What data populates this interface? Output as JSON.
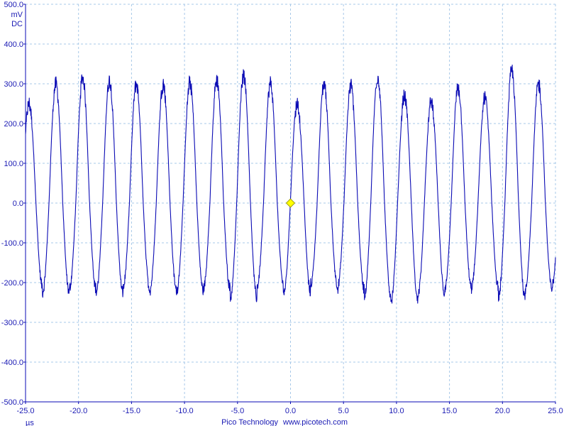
{
  "chart_data": {
    "type": "line",
    "ylabel": "mV",
    "coupling": "DC",
    "xlabel": "µs",
    "xlim": [
      -25.0,
      25.0
    ],
    "ylim": [
      -500.0,
      500.0
    ],
    "x_ticks": [
      "-25.0",
      "-20.0",
      "-15.0",
      "-10.0",
      "-5.0",
      "0.0",
      "5.0",
      "10.0",
      "15.0",
      "20.0",
      "25.0"
    ],
    "y_ticks": [
      "500.0",
      "400.0",
      "300.0",
      "200.0",
      "100.0",
      "0.0",
      "-100.0",
      "-200.0",
      "-300.0",
      "-400.0",
      "-500.0"
    ],
    "grid": true,
    "trigger_marker": {
      "x": 0.0,
      "y": 0.0,
      "color": "#ffff00"
    },
    "series": [
      {
        "color": "#0a0ab4",
        "waveform": "noisy-sine",
        "period_us": 2.53,
        "amplitude_mv": 210,
        "offset_mv": 10,
        "phase_zero_crossing_rising_us": 0.0,
        "peaks_mv": [
          250,
          300,
          295,
          318,
          270,
          255,
          290,
          265,
          332,
          300,
          250,
          300,
          315,
          308,
          300,
          300,
          302,
          310,
          325,
          300
        ],
        "troughs_mv": [
          -225,
          -205,
          -215,
          -235,
          -245,
          -230,
          -215,
          -210,
          -240,
          -215,
          -210,
          -225,
          -215,
          -225,
          -215,
          -220,
          -220,
          -215,
          -240,
          -210
        ]
      }
    ]
  },
  "footer": {
    "brand": "Pico Technology",
    "url": "www.picotech.com"
  },
  "colors": {
    "grid": "#a7c8e8",
    "axis": "#0a0ab4",
    "text": "#1a1ab4",
    "trace": "#0a0ab4"
  }
}
